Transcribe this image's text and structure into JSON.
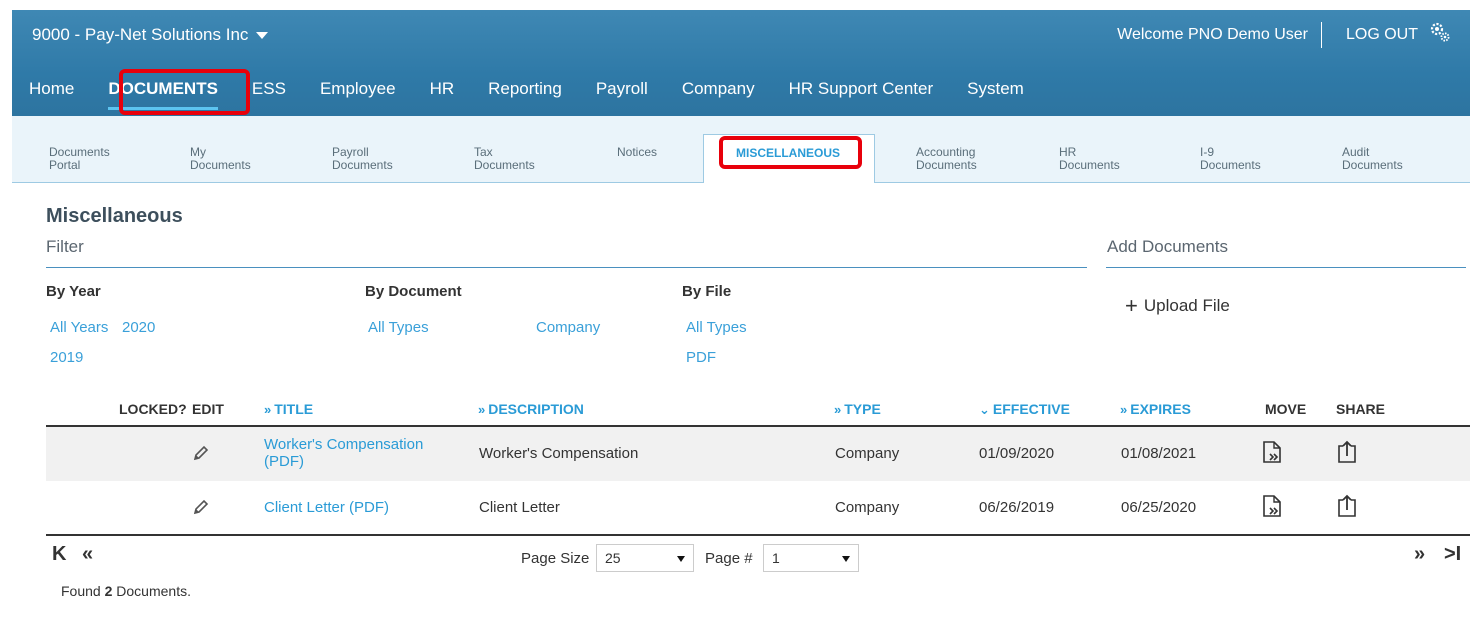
{
  "header": {
    "company": "9000 - Pay-Net Solutions Inc",
    "welcome": "Welcome PNO Demo User",
    "logout": "LOG OUT"
  },
  "main_nav": [
    {
      "label": "Home",
      "active": false
    },
    {
      "label": "DOCUMENTS",
      "active": true
    },
    {
      "label": "ESS",
      "active": false
    },
    {
      "label": "Employee",
      "active": false
    },
    {
      "label": "HR",
      "active": false
    },
    {
      "label": "Reporting",
      "active": false
    },
    {
      "label": "Payroll",
      "active": false
    },
    {
      "label": "Company",
      "active": false
    },
    {
      "label": "HR Support Center",
      "active": false
    },
    {
      "label": "System",
      "active": false
    }
  ],
  "sub_tabs": [
    {
      "line1": "Documents",
      "line2": "Portal"
    },
    {
      "line1": "My",
      "line2": "Documents"
    },
    {
      "line1": "Payroll",
      "line2": "Documents"
    },
    {
      "line1": "Tax",
      "line2": "Documents"
    },
    {
      "line1": "Notices",
      "line2": ""
    },
    {
      "line1": "MISCELLANEOUS",
      "line2": ""
    },
    {
      "line1": "Accounting",
      "line2": "Documents"
    },
    {
      "line1": "HR",
      "line2": "Documents"
    },
    {
      "line1": "I-9",
      "line2": "Documents"
    },
    {
      "line1": "Audit",
      "line2": "Documents"
    }
  ],
  "page": {
    "title": "Miscellaneous",
    "filter_label": "Filter",
    "add_documents_label": "Add Documents",
    "upload_label": "Upload File"
  },
  "filters": {
    "by_year": {
      "label": "By Year",
      "options": [
        "All Years",
        "2020",
        "2019"
      ]
    },
    "by_document": {
      "label": "By Document",
      "options": [
        "All Types",
        "Company"
      ]
    },
    "by_file": {
      "label": "By File",
      "options": [
        "All Types",
        "PDF"
      ]
    }
  },
  "table": {
    "columns": {
      "locked": "LOCKED?",
      "edit": "EDIT",
      "title": "TITLE",
      "description": "DESCRIPTION",
      "type": "TYPE",
      "effective": "EFFECTIVE",
      "expires": "EXPIRES",
      "move": "MOVE",
      "share": "SHARE"
    },
    "rows": [
      {
        "title_line1": "Worker's Compensation",
        "title_line2": "(PDF)",
        "description": "Worker's Compensation",
        "type": "Company",
        "effective": "01/09/2020",
        "expires": "01/08/2021"
      },
      {
        "title_line1": "Client Letter (PDF)",
        "title_line2": "",
        "description": "Client Letter",
        "type": "Company",
        "effective": "06/26/2019",
        "expires": "06/25/2020"
      }
    ]
  },
  "pager": {
    "page_size_label": "Page Size",
    "page_size_value": "25",
    "page_num_label": "Page #",
    "page_num_value": "1",
    "found_prefix": "Found ",
    "found_count": "2",
    "found_suffix": " Documents."
  },
  "colors": {
    "header_blue": "#2f7aa8",
    "link_blue": "#2a9bd6",
    "highlight_red": "#e8000b"
  }
}
